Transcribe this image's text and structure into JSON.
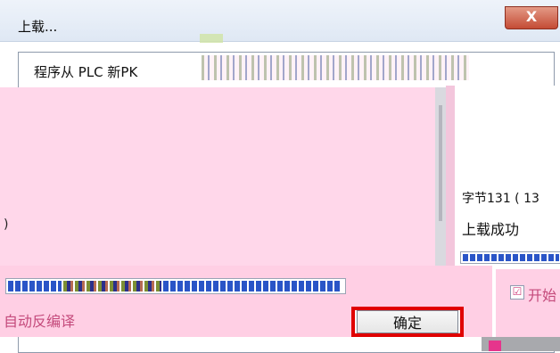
{
  "window": {
    "title": "上载...",
    "close_glyph": "X"
  },
  "message": "程序从 PLC 新PK",
  "status": {
    "bytes": "字节131 ( 13",
    "result": "上载成功",
    "fragment": ")"
  },
  "options": {
    "auto_decompile": "自动反编译",
    "start_label": "开始",
    "start_checked": "☑"
  },
  "buttons": {
    "ok": "确定"
  },
  "progress": {
    "left_fill": 1.0,
    "right_fill": 1.0
  },
  "colors": {
    "highlight_pink": "#ffd7ea",
    "emphasis_red": "#e00000",
    "progress_blue": "#2a55c7"
  }
}
